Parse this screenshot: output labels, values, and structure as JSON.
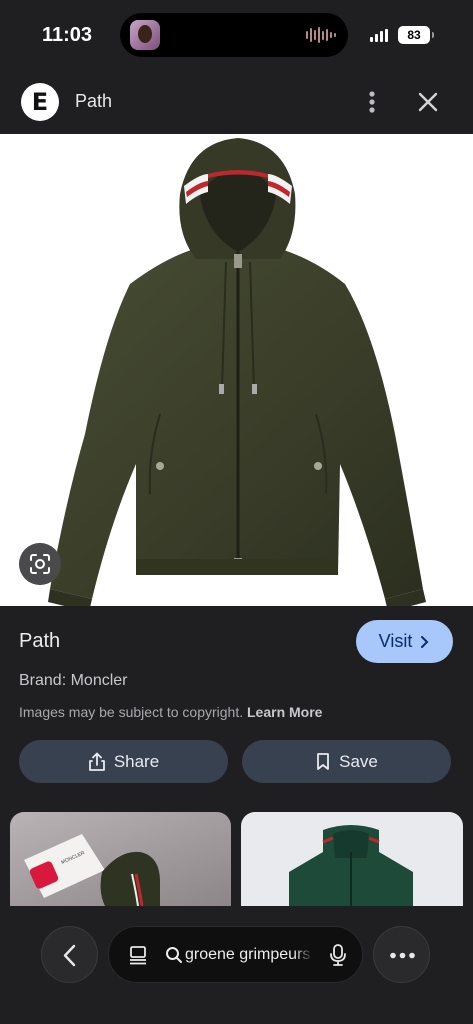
{
  "status": {
    "time": "11:03",
    "battery": "83"
  },
  "header": {
    "site_initial": "E",
    "title": "Path"
  },
  "result": {
    "title": "Path",
    "visit_label": "Visit",
    "brand": "Brand: Moncler",
    "copyright_text": "Images may be subject to copyright.",
    "learn_more": "Learn More",
    "share_label": "Share",
    "save_label": "Save"
  },
  "thumbnails": {
    "box_brand": "MONCLER"
  },
  "bottom": {
    "search_query": "groene grimpeurs"
  },
  "colors": {
    "background": "#1f1f21",
    "visit_button": "#a8c7fa",
    "pill_button": "#38414f",
    "jacket": "#3b3f2a"
  }
}
